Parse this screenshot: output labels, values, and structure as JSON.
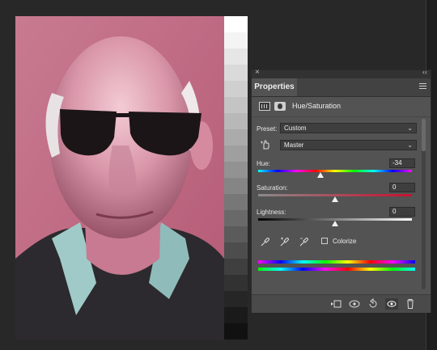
{
  "panel": {
    "close_glyph": "×",
    "collapse_glyph": "‹‹",
    "tab_label": "Properties",
    "adjustment_title": "Hue/Saturation",
    "preset_label": "Preset:",
    "preset_value": "Custom",
    "channel_value": "Master",
    "hue_label": "Hue:",
    "hue_value": "-34",
    "saturation_label": "Saturation:",
    "saturation_value": "0",
    "lightness_label": "Lightness:",
    "lightness_value": "0",
    "colorize_label": "Colorize",
    "colorize_checked": false
  },
  "icons": {
    "close": "close-icon",
    "collapse": "collapse-icon",
    "menu": "panel-menu-icon",
    "adjustment": "hue-saturation-adjustment-icon",
    "mask": "layer-mask-icon",
    "targeted_adjustment": "targeted-adjustment-hand-icon",
    "eyedroppers": [
      "eyedropper-icon",
      "add-to-sample-eyedropper-icon",
      "subtract-from-sample-eyedropper-icon"
    ],
    "bottom": [
      "clip-to-layer-icon",
      "view-previous-state-icon",
      "reset-icon",
      "visibility-icon",
      "trash-icon"
    ]
  },
  "sliders": {
    "hue": {
      "min": -180,
      "max": 180,
      "value": -34
    },
    "saturation": {
      "min": -100,
      "max": 100,
      "value": 0
    },
    "lightness": {
      "min": -100,
      "max": 100,
      "value": 0
    }
  },
  "colors": {
    "panel_bg": "#535353",
    "field_bg": "#3e3e3e",
    "photo_tint": "#c86a86"
  }
}
